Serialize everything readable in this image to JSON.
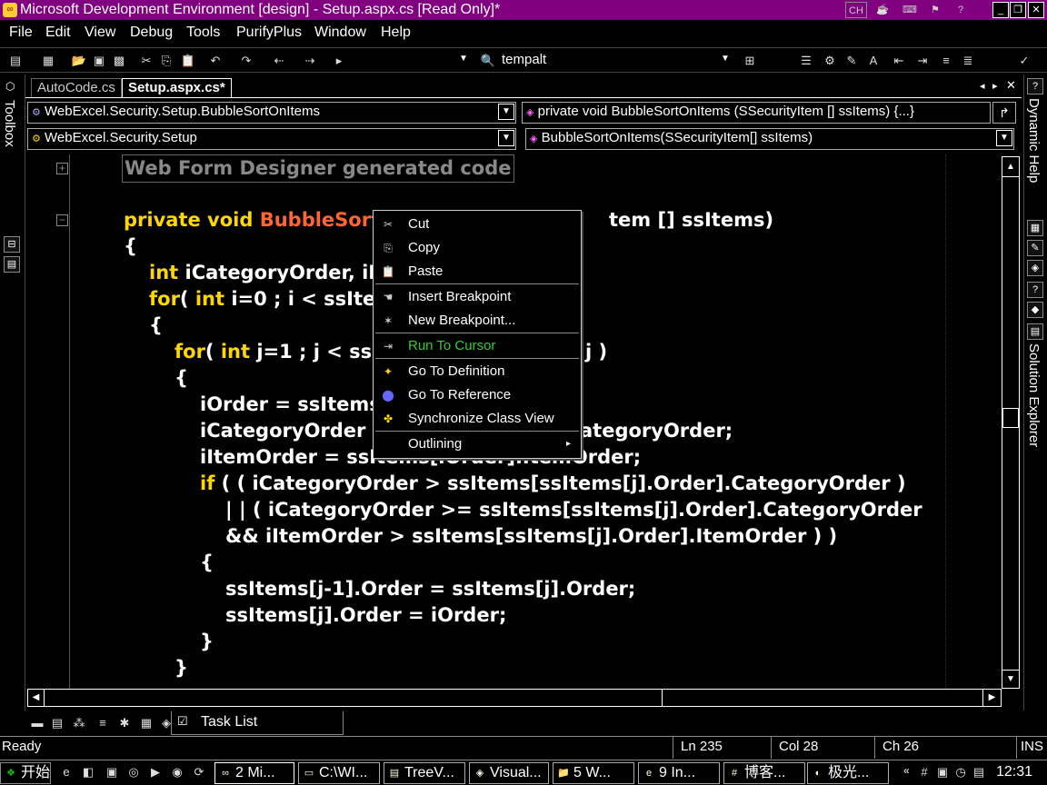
{
  "window": {
    "title": "Microsoft Development Environment [design] - Setup.aspx.cs [Read Only]*",
    "lang_indicator": "CH"
  },
  "menu": [
    "File",
    "Edit",
    "View",
    "Debug",
    "Tools",
    "PurifyPlus",
    "Window",
    "Help"
  ],
  "toolbar": {
    "config_combo": "tempalt"
  },
  "dock": {
    "left_label": "Toolbox",
    "right_top_label": "Dynamic Help",
    "right_bottom_label": "Solution Explorer"
  },
  "tabs": [
    {
      "label": "AutoCode.cs",
      "active": false
    },
    {
      "label": "Setup.aspx.cs*",
      "active": true
    }
  ],
  "nav": {
    "class_combo": "WebExcel.Security.Setup.BubbleSortOnItems",
    "member_combo": "private void BubbleSortOnItems (SSecurityItem [] ssItems) {...}",
    "namespace_combo": "WebExcel.Security.Setup",
    "method_combo": "BubbleSortOnItems(SSecurityItem[] ssItems)"
  },
  "code": {
    "region": "Web Form Designer generated code",
    "line_sig_kw": "private void ",
    "line_sig_fn": "BubbleSort",
    "line_sig_rest": "tem [] ssItems)",
    "l_open1": "{",
    "l_int_kw": "int",
    "l_int_rest": " iCategoryOrder, iI",
    "l_for1_kw": "for",
    "l_for1_a": "( ",
    "l_for1_kw2": "int",
    "l_for1_b": " i=0 ; i < ssIte",
    "l_open2": "{",
    "l_for2_kw": "for",
    "l_for2_a": "( ",
    "l_for2_kw2": "int",
    "l_for2_b": " j=1 ; j < ss",
    "l_for2_c": "j )",
    "l_open3": "{",
    "l_iorder": "iOrder = ssItems",
    "l_icat": "iCategoryOrder = ",
    "l_icat_end": "ategoryOrder;",
    "l_iitem": "iItemOrder = ssItems[iOrder].ItemOrder;",
    "l_if_kw": "if",
    "l_if_rest": " ( ( iCategoryOrder > ssItems[ssItems[j].Order].CategoryOrder )",
    "l_or": "| | ( iCategoryOrder >= ssItems[ssItems[j].Order].CategoryOrder",
    "l_and": "&& iItemOrder > ssItems[ssItems[j].Order].ItemOrder ) )",
    "l_open4": "{",
    "l_assign1": "ssItems[j-1].Order = ssItems[j].Order;",
    "l_assign2": "ssItems[j].Order = iOrder;",
    "l_close4": "}",
    "l_close3": "}"
  },
  "context_menu": {
    "items": [
      {
        "label": "Cut",
        "icon": "scissors-icon"
      },
      {
        "label": "Copy",
        "icon": "copy-icon"
      },
      {
        "label": "Paste",
        "icon": "paste-icon"
      },
      {
        "label": "Insert Breakpoint",
        "icon": "hand-icon"
      },
      {
        "label": "New Breakpoint...",
        "icon": "new-breakpoint-icon"
      },
      {
        "label": "Run To Cursor",
        "icon": "run-to-cursor-icon",
        "color": "#33cc33"
      },
      {
        "label": "Go To Definition",
        "icon": "definition-icon"
      },
      {
        "label": "Go To Reference",
        "icon": "reference-icon"
      },
      {
        "label": "Synchronize Class View",
        "icon": "sync-icon"
      },
      {
        "label": "Outlining",
        "icon": "submenu-arrow-icon"
      }
    ]
  },
  "task_list_label": "Task List",
  "status": {
    "ready": "Ready",
    "ln": "Ln 235",
    "col": "Col 28",
    "ch": "Ch 26",
    "ins": "INS"
  },
  "taskbar": {
    "start": "开始",
    "tasks": [
      "2 Mi...",
      "C:\\WI...",
      "TreeV...",
      "Visual...",
      "5 W...",
      "9 In...",
      "博客...",
      "极光..."
    ],
    "clock": "12:31"
  }
}
